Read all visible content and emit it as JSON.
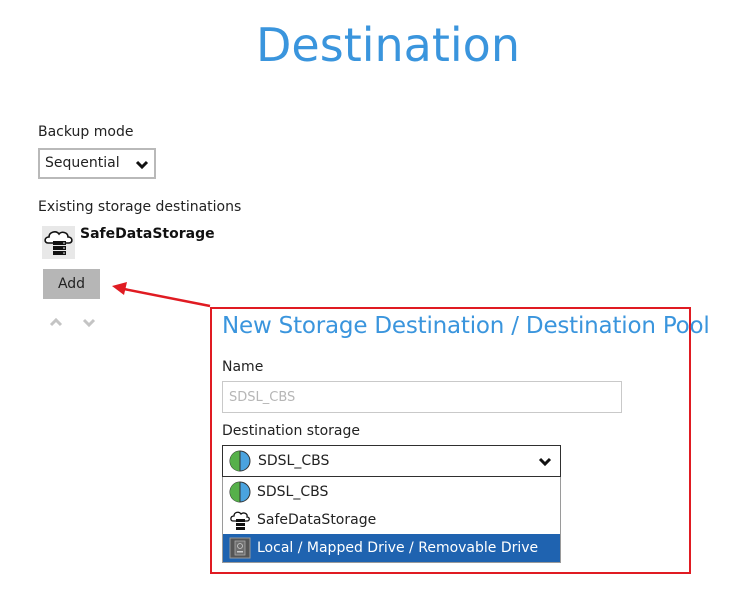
{
  "page": {
    "title": "Destination"
  },
  "backup_mode": {
    "label": "Backup mode",
    "selected": "Sequential"
  },
  "existing_storage": {
    "label": "Existing storage destinations",
    "items": [
      {
        "name": "SafeDataStorage",
        "icon": "cloud-storage-icon"
      }
    ]
  },
  "actions": {
    "add_label": "Add",
    "move_up_icon": "chevron-up-icon",
    "move_down_icon": "chevron-down-icon"
  },
  "new_destination": {
    "title": "New Storage Destination / Destination Pool",
    "name_label": "Name",
    "name_placeholder": "SDSL_CBS",
    "destination_storage_label": "Destination storage",
    "selected": {
      "label": "SDSL_CBS",
      "icon": "sdsl-globe-icon"
    },
    "options": [
      {
        "label": "SDSL_CBS",
        "icon": "sdsl-globe-icon",
        "selected": false
      },
      {
        "label": "SafeDataStorage",
        "icon": "cloud-storage-icon",
        "selected": false
      },
      {
        "label": "Local / Mapped Drive / Removable Drive",
        "icon": "local-drive-icon",
        "selected": true
      }
    ]
  },
  "colors": {
    "title_blue": "#3a95dd",
    "callout_red": "#e01b22",
    "selection_blue": "#1f63b0",
    "button_gray": "#b6b6b6"
  }
}
